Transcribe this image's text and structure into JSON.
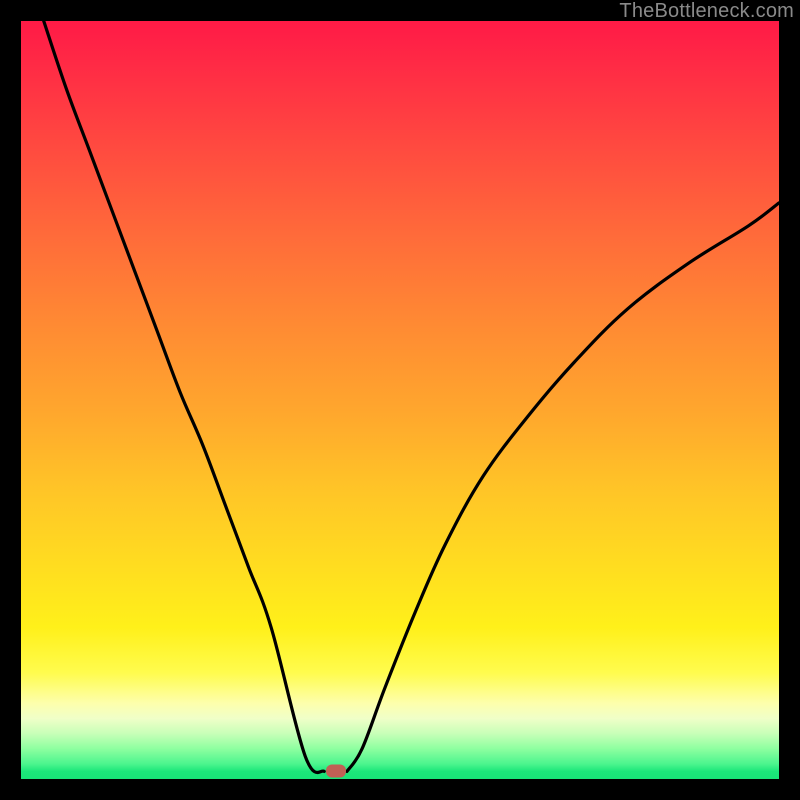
{
  "watermark": "TheBottleneck.com",
  "chart_data": {
    "type": "line",
    "title": "",
    "xlabel": "",
    "ylabel": "",
    "xlim": [
      0,
      100
    ],
    "ylim": [
      0,
      100
    ],
    "grid": false,
    "gradient_colors": {
      "top": "#ff1a46",
      "mid": "#ffdd20",
      "bottom": "#18e377"
    },
    "series": [
      {
        "name": "bottleneck-curve-left",
        "x": [
          3,
          6,
          9,
          12,
          15,
          18,
          21,
          24,
          27,
          30,
          33,
          37.5,
          40
        ],
        "y": [
          100,
          91,
          83,
          75,
          67,
          59,
          51,
          44,
          36,
          28,
          20,
          3,
          1
        ]
      },
      {
        "name": "bottleneck-curve-right",
        "x": [
          43,
          45,
          48,
          52,
          56,
          61,
          67,
          73,
          80,
          88,
          96,
          100
        ],
        "y": [
          1,
          4,
          12,
          22,
          31,
          40,
          48,
          55,
          62,
          68,
          73,
          76
        ]
      }
    ],
    "marker": {
      "x": 41.5,
      "y": 1
    }
  }
}
